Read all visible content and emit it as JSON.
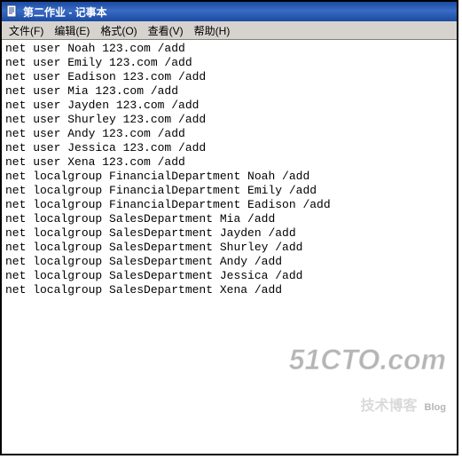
{
  "window": {
    "title": "第二作业 - 记事本"
  },
  "menu": {
    "file": "文件(F)",
    "edit": "编辑(E)",
    "format": "格式(O)",
    "view": "查看(V)",
    "help": "帮助(H)"
  },
  "lines": [
    "net user Noah 123.com /add",
    "net user Emily 123.com /add",
    "net user Eadison 123.com /add",
    "net user Mia 123.com /add",
    "net user Jayden 123.com /add",
    "net user Shurley 123.com /add",
    "net user Andy 123.com /add",
    "net user Jessica 123.com /add",
    "net user Xena 123.com /add",
    "net localgroup FinancialDepartment Noah /add",
    "net localgroup FinancialDepartment Emily /add",
    "net localgroup FinancialDepartment Eadison /add",
    "net localgroup SalesDepartment Mia /add",
    "net localgroup SalesDepartment Jayden /add",
    "net localgroup SalesDepartment Shurley /add",
    "net localgroup SalesDepartment Andy /add",
    "net localgroup SalesDepartment Jessica /add",
    "net localgroup SalesDepartment Xena /add"
  ],
  "watermark": {
    "main": "51CTO.com",
    "cn": "技术博客",
    "blog": "Blog"
  }
}
